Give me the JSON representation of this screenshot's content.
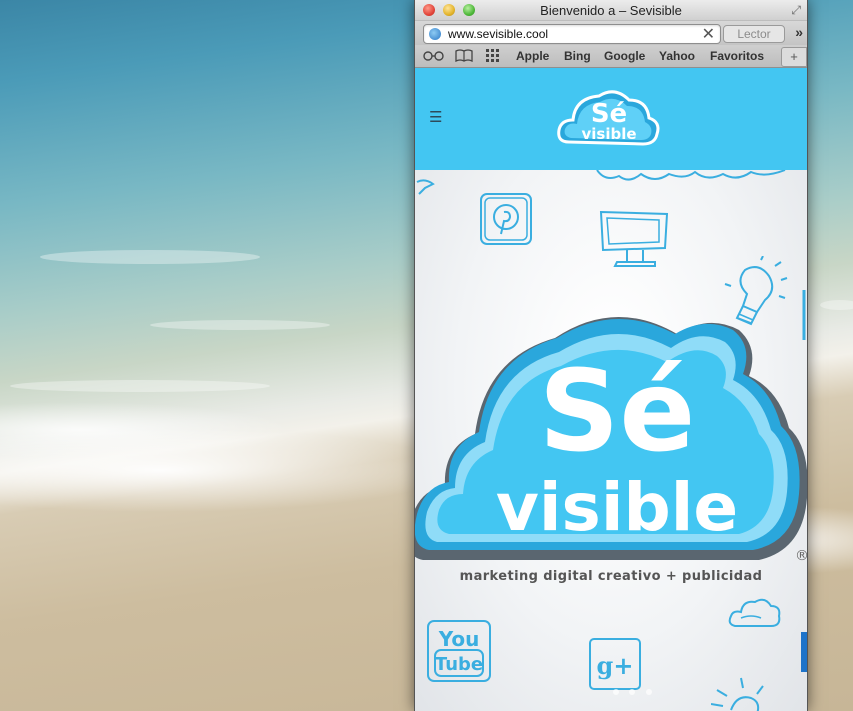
{
  "window": {
    "title": "Bienvenido a – Sevisible"
  },
  "toolbar": {
    "url": "www.sevisible.cool",
    "reader_label": "Lector",
    "overflow_symbol": "»"
  },
  "bookmarks": {
    "items": [
      {
        "label": "Apple"
      },
      {
        "label": "Bing"
      },
      {
        "label": "Google"
      },
      {
        "label": "Yahoo"
      },
      {
        "label": "Favoritos"
      }
    ],
    "icons": [
      "reading-list-icon",
      "bookmarks-book-icon",
      "top-sites-grid-icon"
    ]
  },
  "site": {
    "header_logo_line1": "Sé",
    "header_logo_line2": "visible",
    "hero_logo_line1": "Sé",
    "hero_logo_line2": "visible",
    "registered_mark": "®",
    "tagline": "marketing digital creativo + publicidad",
    "youtube_line1": "You",
    "youtube_line2": "Tube",
    "gplus": "g+",
    "brand_color": "#43c6f2",
    "accent_color": "#1d73c9"
  }
}
